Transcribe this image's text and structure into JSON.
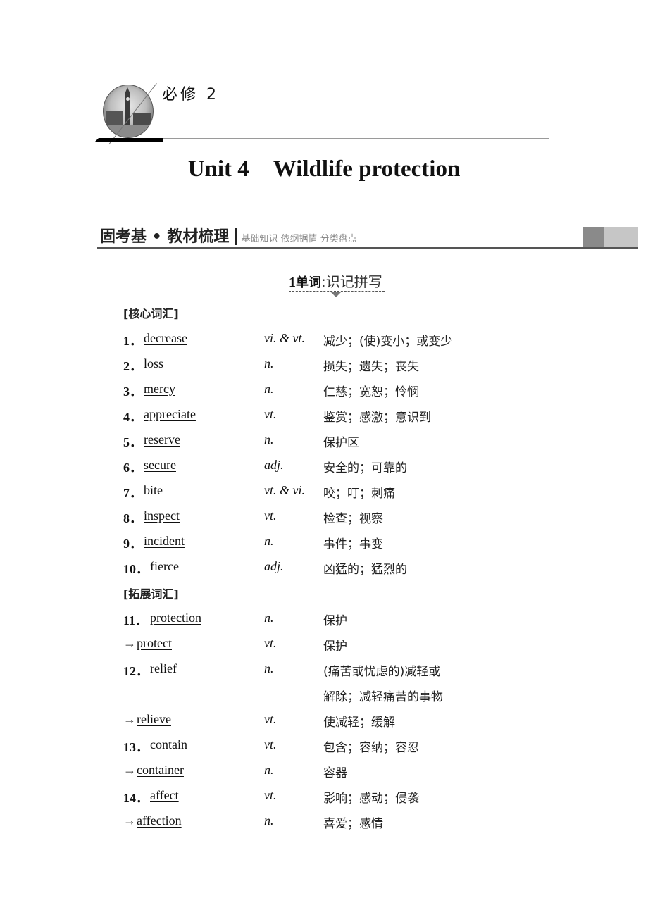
{
  "header": {
    "book_label": "必修 2",
    "unit_number": "Unit 4",
    "unit_title": "Wildlife protection"
  },
  "section": {
    "title": "固考基 • 教材梳理",
    "subtitle": "基础知识  依纲据情  分类盘点"
  },
  "subsection": {
    "number": "1",
    "keyword": "单词",
    "separator": ":",
    "rest": "识记拼写"
  },
  "vocab": {
    "core_label": "[核心词汇]",
    "extended_label": "[拓展词汇]",
    "core": [
      {
        "index": "1．",
        "word": "decrease",
        "pos": "vi. & vt.",
        "meaning": "减少；(使)变小；或变少"
      },
      {
        "index": "2．",
        "word": "loss",
        "pos": "n.",
        "meaning": "损失；遗失；丧失"
      },
      {
        "index": "3．",
        "word": "mercy",
        "pos": "n.",
        "meaning": "仁慈；宽恕；怜悯"
      },
      {
        "index": "4．",
        "word": "appreciate",
        "pos": "vt.",
        "meaning": "鉴赏；感激；意识到"
      },
      {
        "index": "5．",
        "word": "reserve",
        "pos": "n.",
        "meaning": "保护区"
      },
      {
        "index": "6．",
        "word": "secure",
        "pos": "adj.",
        "meaning": "安全的；可靠的"
      },
      {
        "index": "7．",
        "word": "bite",
        "pos": "vt. & vi.",
        "meaning": "咬；叮；刺痛"
      },
      {
        "index": "8．",
        "word": "inspect",
        "pos": "vt.",
        "meaning": "检查；视察"
      },
      {
        "index": "9．",
        "word": "incident",
        "pos": "n.",
        "meaning": "事件；事变"
      },
      {
        "index": "10．",
        "word": "fierce",
        "pos": "adj.",
        "meaning": "凶猛的；猛烈的"
      }
    ],
    "extended": [
      {
        "index": "11．",
        "word": "protection",
        "pos": "n.",
        "meaning": "保护"
      },
      {
        "arrow": "→",
        "word": "protect",
        "pos": "vt.",
        "meaning": "保护"
      },
      {
        "index": "12．",
        "word": "relief",
        "pos": "n.",
        "meaning": "(痛苦或忧虑的)减轻或",
        "meaning2": "解除；减轻痛苦的事物"
      },
      {
        "arrow": "→",
        "word": "relieve",
        "pos": "vt.",
        "meaning": "使减轻；缓解"
      },
      {
        "index": "13．",
        "word": "contain",
        "pos": "vt.",
        "meaning": "包含；容纳；容忍"
      },
      {
        "arrow": "→",
        "word": "container",
        "pos": "n.",
        "meaning": "容器"
      },
      {
        "index": "14．",
        "word": "affect",
        "pos": "vt.",
        "meaning": "影响；感动；侵袭"
      },
      {
        "arrow": "→",
        "word": "affection",
        "pos": "n.",
        "meaning": "喜爱；感情"
      }
    ]
  }
}
